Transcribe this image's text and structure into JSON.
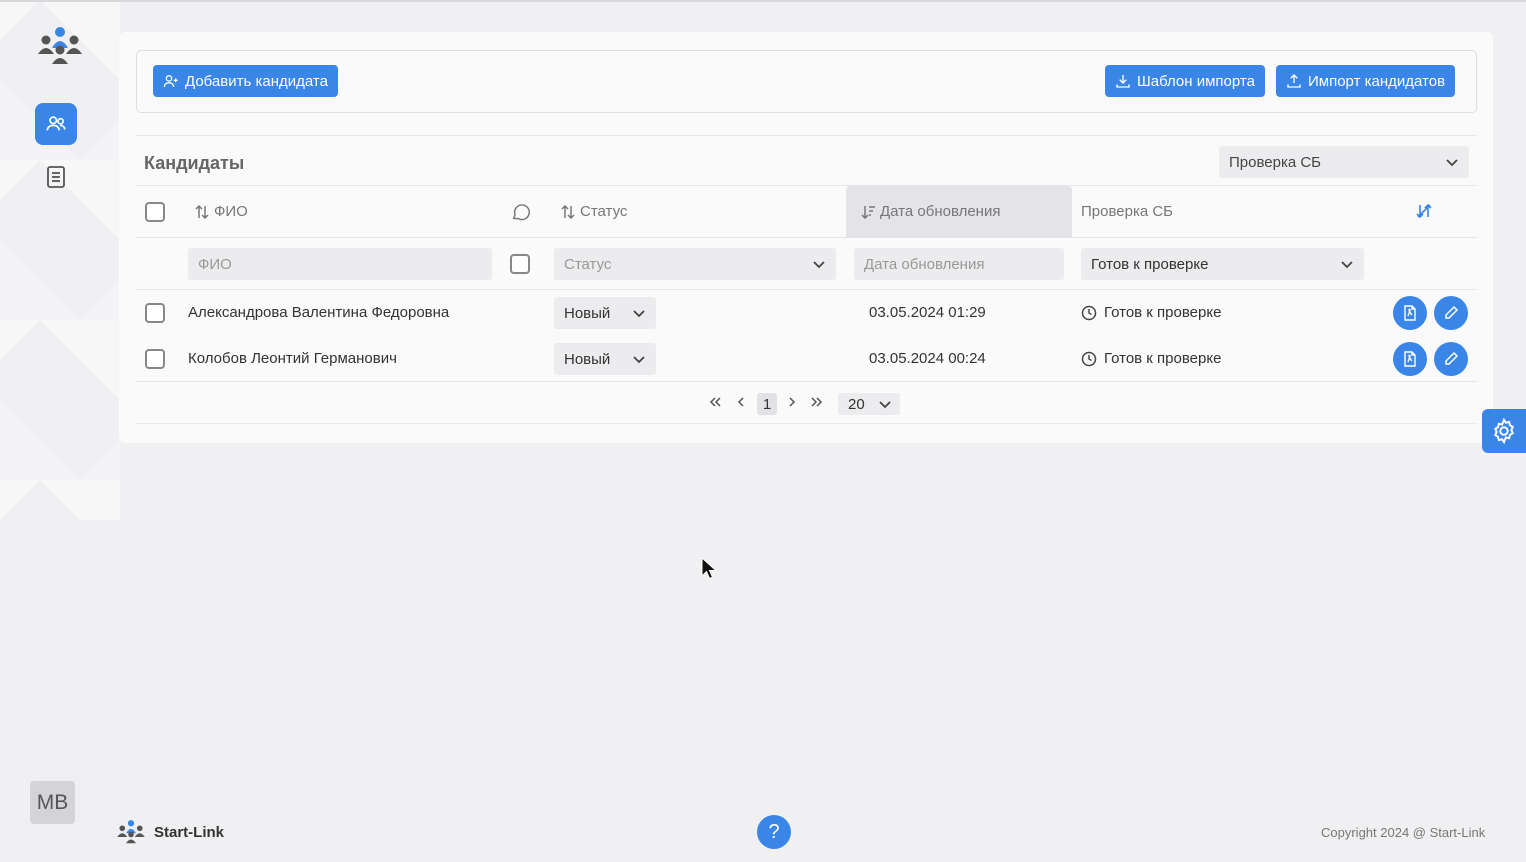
{
  "toolbar": {
    "add_label": "Добавить кандидата",
    "template_label": "Шаблон импорта",
    "import_label": "Импорт кандидатов"
  },
  "section": {
    "title": "Кандидаты",
    "view_select": "Проверка СБ"
  },
  "table": {
    "columns": {
      "name": "ФИО",
      "status": "Статус",
      "updated": "Дата обновления",
      "check": "Проверка СБ"
    },
    "filters": {
      "name_placeholder": "ФИО",
      "status_placeholder": "Статус",
      "updated_placeholder": "Дата обновления",
      "check_value": "Готов к проверке"
    },
    "rows": [
      {
        "name": "Александрова Валентина Федоровна",
        "status": "Новый",
        "updated": "03.05.2024 01:29",
        "check": "Готов к проверке"
      },
      {
        "name": "Колобов Леонтий Германович",
        "status": "Новый",
        "updated": "03.05.2024 00:24",
        "check": "Готов к проверке"
      }
    ]
  },
  "pagination": {
    "current_page": "1",
    "page_size": "20"
  },
  "user": {
    "initials": "MB"
  },
  "footer": {
    "brand": "Start-Link",
    "help": "?",
    "copyright": "Copyright 2024 @ Start-Link"
  },
  "colors": {
    "accent": "#3a86e8",
    "background": "#f0f0f2"
  }
}
